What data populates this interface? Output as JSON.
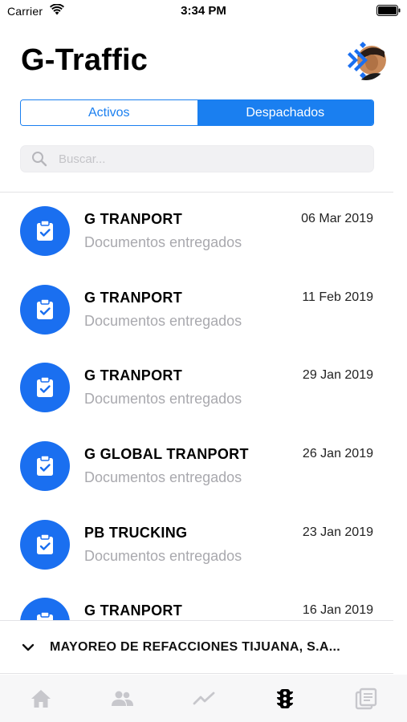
{
  "status_bar": {
    "carrier": "Carrier",
    "time": "3:34 PM",
    "wifi_icon": "wifi-icon",
    "battery_icon": "battery-icon"
  },
  "header": {
    "title": "G-Traffic",
    "avatar_icon": "user-avatar"
  },
  "segmented_control": {
    "segments": [
      {
        "label": "Activos",
        "selected": false
      },
      {
        "label": "Despachados",
        "selected": true
      }
    ]
  },
  "search": {
    "placeholder": "Buscar...",
    "icon": "search-icon"
  },
  "shipments": [
    {
      "company": "G TRANPORT",
      "date": "06 Mar 2019",
      "status": "Documentos entregados",
      "icon": "clipboard-check-icon"
    },
    {
      "company": "G TRANPORT",
      "date": "11 Feb 2019",
      "status": "Documentos entregados",
      "icon": "clipboard-check-icon"
    },
    {
      "company": "G TRANPORT",
      "date": "29 Jan 2019",
      "status": "Documentos entregados",
      "icon": "clipboard-check-icon"
    },
    {
      "company": "G GLOBAL TRANPORT",
      "date": "26 Jan 2019",
      "status": "Documentos entregados",
      "icon": "clipboard-check-icon"
    },
    {
      "company": "PB TRUCKING",
      "date": "23 Jan 2019",
      "status": "Documentos entregados",
      "icon": "clipboard-check-icon"
    },
    {
      "company": "G TRANPORT",
      "date": "16 Jan 2019",
      "status": "",
      "icon": "clipboard-check-icon"
    }
  ],
  "client_selector": {
    "name": "MAYOREO DE REFACCIONES TIJUANA, S.A...",
    "icon": "chevron-down-icon"
  },
  "tab_bar": {
    "tabs": [
      {
        "icon": "home-icon",
        "selected": false
      },
      {
        "icon": "users-icon",
        "selected": false
      },
      {
        "icon": "trending-icon",
        "selected": false
      },
      {
        "icon": "traffic-light-icon",
        "selected": true
      },
      {
        "icon": "documents-icon",
        "selected": false
      }
    ]
  },
  "colors": {
    "accent": "#1a7ff0",
    "icon_circle": "#1a6ff0",
    "muted_text": "#a9a9ae",
    "tab_inactive": "#c7c7cc",
    "tab_active": "#000000"
  }
}
